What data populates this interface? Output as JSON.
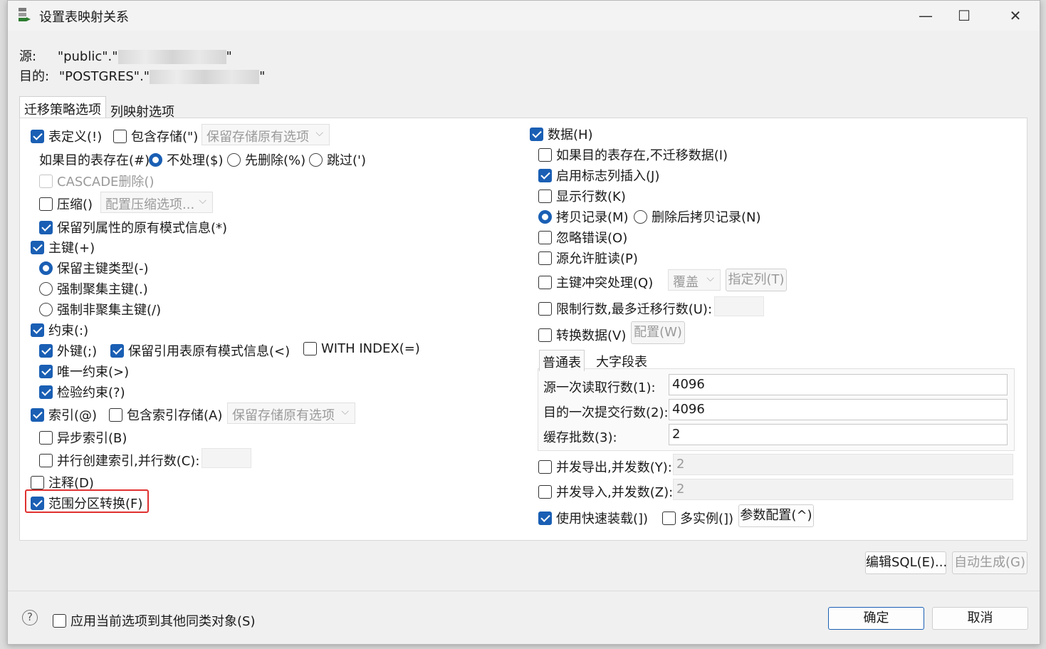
{
  "window": {
    "title": "设置表映射关系",
    "minimize": "—",
    "maximize": "☐",
    "close": "✕"
  },
  "header": {
    "source_label": "源:",
    "source_value": "\"public\".\"",
    "dest_label": "目的:",
    "dest_value": "\"POSTGRES\".\"",
    "quote_end": "\""
  },
  "tabs": [
    "迁移策略选项",
    "列映射选项"
  ],
  "left": {
    "table_def": "表定义(!)",
    "include_storage": "包含存储(\")",
    "keep_storage_option": "保留存储原有选项",
    "if_dest_exists": "如果目的表存在(#)",
    "no_process": "不处理($)",
    "drop_first": "先删除(%)",
    "skip": "跳过(')",
    "cascade_delete": "CASCADE删除()",
    "compress": "压缩()",
    "config_compress": "配置压缩选项...",
    "keep_col_attr": "保留列属性的原有模式信息(*)",
    "primary_key": "主键(+)",
    "keep_pk_type": "保留主键类型(-)",
    "force_cluster_pk": "强制聚集主键(.)",
    "force_noncluster_pk": "强制非聚集主键(/)",
    "constraint": "约束(:)",
    "foreign_key": "外键(;)",
    "keep_ref_schema": "保留引用表原有模式信息(<)",
    "with_index": "WITH INDEX(=)",
    "unique": "唯一约束(>)",
    "check": "检验约束(?)",
    "index": "索引(@)",
    "include_index_storage": "包含索引存储(A)",
    "keep_index_storage": "保留存储原有选项",
    "async_index": "异步索引(B)",
    "parallel_index": "并行创建索引,并行数(C):",
    "comment": "注释(D)",
    "range_partition": "范围分区转换(F)"
  },
  "right": {
    "data": "数据(H)",
    "no_migrate_if_exists": "如果目的表存在,不迁移数据(I)",
    "identity_insert": "启用标志列插入(J)",
    "show_rows": "显示行数(K)",
    "copy_records": "拷贝记录(M)",
    "delete_then_copy": "删除后拷贝记录(N)",
    "ignore_errors": "忽略错误(O)",
    "dirty_read": "源允许脏读(P)",
    "pk_conflict": "主键冲突处理(Q)",
    "overwrite": "覆盖",
    "specify_cols": "指定列(T)",
    "limit_rows": "限制行数,最多迁移行数(U):",
    "convert_data": "转换数据(V)",
    "config_w": "配置(W)",
    "subtab_normal": "普通表",
    "subtab_large": "大字段表",
    "read_rows_label": "源一次读取行数(1):",
    "read_rows_value": "4096",
    "commit_rows_label": "目的一次提交行数(2):",
    "commit_rows_value": "4096",
    "cache_batch_label": "缓存批数(3):",
    "cache_batch_value": "2",
    "parallel_export": "并发导出,并发数(Y):",
    "parallel_export_value": "2",
    "parallel_import": "并发导入,并发数(Z):",
    "parallel_import_value": "2",
    "fast_load": "使用快速装载(])",
    "multi_instance": "多实例(])",
    "param_config": "参数配置(^)"
  },
  "actions": {
    "edit_sql": "编辑SQL(E)...",
    "auto_gen": "自动生成(G)"
  },
  "footer": {
    "help": "?",
    "apply_to_similar": "应用当前选项到其他同类对象(S)",
    "ok": "确定",
    "cancel": "取消"
  },
  "colors": {
    "accent": "#1a5fb4",
    "highlight": "#e03030"
  }
}
